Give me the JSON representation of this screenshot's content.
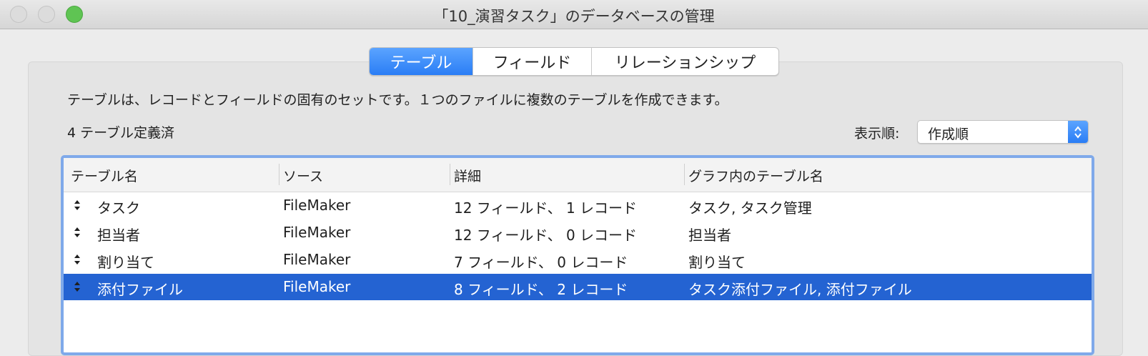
{
  "window": {
    "title": "「10_演習タスク」のデータベースの管理"
  },
  "tabs": [
    {
      "label": "テーブル",
      "selected": true
    },
    {
      "label": "フィールド",
      "selected": false
    },
    {
      "label": "リレーションシップ",
      "selected": false
    }
  ],
  "description": "テーブルは、レコードとフィールドの固有のセットです。１つのファイルに複数のテーブルを作成できます。",
  "table_count": "4 テーブル定義済",
  "sort": {
    "label": "表示順:",
    "value": "作成順"
  },
  "columns": [
    "テーブル名",
    "ソース",
    "詳細",
    "グラフ内のテーブル名"
  ],
  "rows": [
    {
      "name": "タスク",
      "source": "FileMaker",
      "details": "12 フィールド、 1 レコード",
      "graph_names": "タスク, タスク管理",
      "selected": false
    },
    {
      "name": "担当者",
      "source": "FileMaker",
      "details": "12 フィールド、 0 レコード",
      "graph_names": "担当者",
      "selected": false
    },
    {
      "name": "割り当て",
      "source": "FileMaker",
      "details": "7 フィールド、 0 レコード",
      "graph_names": "割り当て",
      "selected": false
    },
    {
      "name": "添付ファイル",
      "source": "FileMaker",
      "details": "8 フィールド、 2 レコード",
      "graph_names": "タスク添付ファイル, 添付ファイル",
      "selected": true
    }
  ],
  "colors": {
    "accent": "#2a7df5",
    "selection": "#2463d2",
    "table_focus_ring": "#7fa9ea",
    "zoom_button": "#5fc453"
  }
}
